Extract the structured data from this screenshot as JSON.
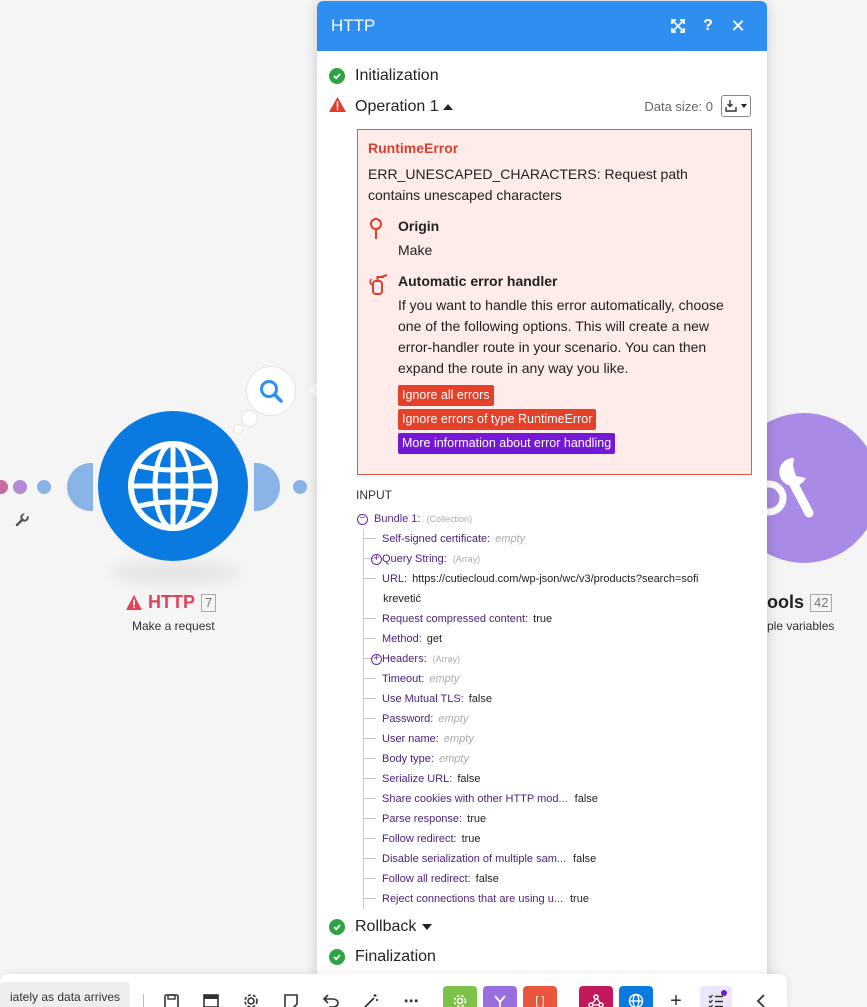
{
  "canvas": {
    "http_node": {
      "title": "HTTP",
      "id": "7",
      "subtitle": "Make a request",
      "color": "#0a7ae0"
    },
    "tools_node": {
      "title": "ools",
      "id": "42",
      "subtitle": "ple variables",
      "color": "#9b6ee0"
    }
  },
  "panel": {
    "title": "HTTP",
    "header_color": "#2f8ff0",
    "sections": {
      "initialization": "Initialization",
      "operation": "Operation 1",
      "rollback": "Rollback",
      "finalization": "Finalization"
    },
    "data_size_label": "Data size: 0",
    "error": {
      "title": "RuntimeError",
      "message": "ERR_UNESCAPED_CHARACTERS: Request path contains unescaped characters",
      "origin_heading": "Origin",
      "origin_value": "Make",
      "handler_heading": "Automatic error handler",
      "handler_text": "If you want to handle this error automatically, choose one of the following options. This will create a new error-handler route in your scenario. You can then expand the route in any way you like.",
      "buttons": {
        "ignore_all": "Ignore all errors",
        "ignore_type": "Ignore errors of type RuntimeError",
        "more_info": "More information about error handling"
      }
    },
    "input": {
      "label": "INPUT",
      "bundle_label": "Bundle 1:",
      "bundle_tag": "(Collection)",
      "rows": [
        {
          "key": "Self-signed certificate:",
          "value": "empty",
          "empty": true
        },
        {
          "key": "Query String:",
          "value": "(Array)",
          "expand": true
        },
        {
          "key": "URL:",
          "value": "https://cutiecloud.com/wp-json/wc/v3/products?search=sofi",
          "value2": "krevetić"
        },
        {
          "key": "Request compressed content:",
          "value": "true"
        },
        {
          "key": "Method:",
          "value": "get"
        },
        {
          "key": "Headers:",
          "value": "(Array)",
          "expand": true
        },
        {
          "key": "Timeout:",
          "value": "empty",
          "empty": true
        },
        {
          "key": "Use Mutual TLS:",
          "value": "false"
        },
        {
          "key": "Password:",
          "value": "empty",
          "empty": true
        },
        {
          "key": "User name:",
          "value": "empty",
          "empty": true
        },
        {
          "key": "Body type:",
          "value": "empty",
          "empty": true
        },
        {
          "key": "Serialize URL:",
          "value": "false"
        },
        {
          "key": "Share cookies with other HTTP mod...",
          "value": "false"
        },
        {
          "key": "Parse response:",
          "value": "true"
        },
        {
          "key": "Follow redirect:",
          "value": "true"
        },
        {
          "key": "Disable serialization of multiple sam...",
          "value": "false"
        },
        {
          "key": "Follow all redirect:",
          "value": "false"
        },
        {
          "key": "Reject connections that are using u...",
          "value": "true"
        }
      ]
    }
  },
  "toolbar": {
    "schedule_text": "iately as data arrives",
    "tiles": {
      "tools_color": "#7cc24a",
      "flow_color": "#9b6ee0",
      "json_color": "#e8573c",
      "webhook_color": "#c2185b",
      "http_color": "#0a7ae0"
    }
  }
}
